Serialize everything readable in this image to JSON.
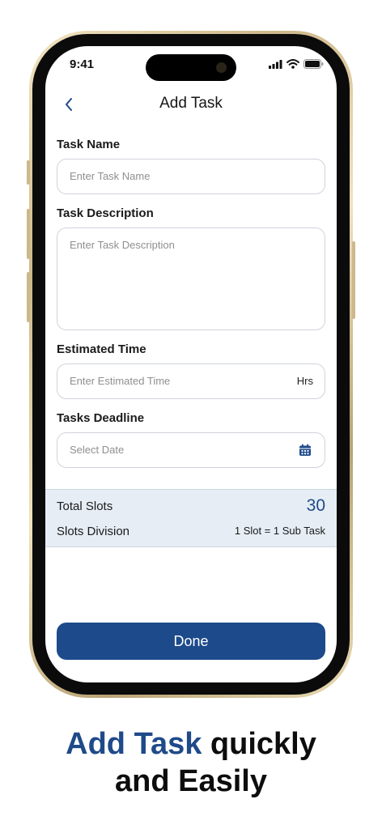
{
  "status_bar": {
    "time": "9:41"
  },
  "header": {
    "title": "Add Task"
  },
  "form": {
    "task_name": {
      "label": "Task Name",
      "placeholder": "Enter Task Name"
    },
    "task_description": {
      "label": "Task Description",
      "placeholder": "Enter Task Description"
    },
    "estimated_time": {
      "label": "Estimated Time",
      "placeholder": "Enter Estimated Time",
      "unit": "Hrs"
    },
    "deadline": {
      "label": "Tasks Deadline",
      "placeholder": "Select Date"
    }
  },
  "slots": {
    "total_label": "Total Slots",
    "total_value": "30",
    "division_label": "Slots Division",
    "division_value": "1 Slot = 1 Sub Task"
  },
  "actions": {
    "done_label": "Done"
  },
  "caption": {
    "highlight": "Add Task",
    "line1_rest": " quickly",
    "line2": "and Easily"
  },
  "colors": {
    "brand": "#1D4A8B",
    "panel": "#E6EDF5"
  },
  "icons": [
    "back-chevron-icon",
    "signal-icon",
    "wifi-icon",
    "battery-icon",
    "calendar-icon"
  ]
}
